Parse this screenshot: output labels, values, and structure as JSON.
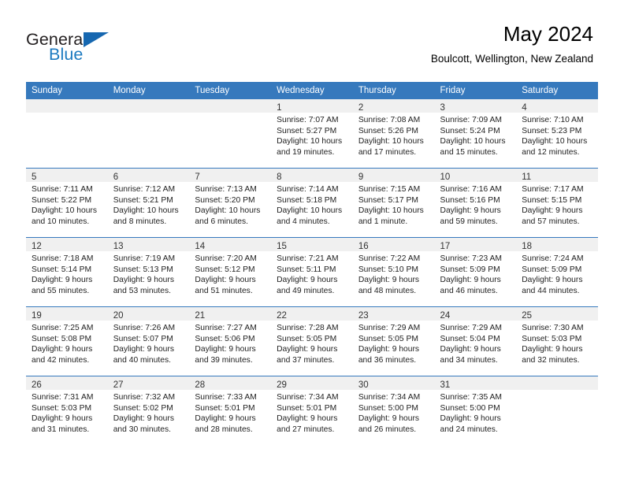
{
  "brand": {
    "name_part1": "General",
    "name_part2": "Blue",
    "triangle_icon": "triangle-icon",
    "color_dark": "#231f20",
    "color_blue": "#1c7ac0"
  },
  "header": {
    "title": "May 2024",
    "subtitle": "Boulcott, Wellington, New Zealand"
  },
  "theme": {
    "header_bg": "#3679bd",
    "daynum_bg": "#f0f0f0",
    "grid_line": "#3679bd"
  },
  "weekday_headers": [
    "Sunday",
    "Monday",
    "Tuesday",
    "Wednesday",
    "Thursday",
    "Friday",
    "Saturday"
  ],
  "weeks": [
    [
      {
        "day": "",
        "empty": true,
        "sunrise": "",
        "sunset": "",
        "daylight_1": "",
        "daylight_2": ""
      },
      {
        "day": "",
        "empty": true,
        "sunrise": "",
        "sunset": "",
        "daylight_1": "",
        "daylight_2": ""
      },
      {
        "day": "",
        "empty": true,
        "sunrise": "",
        "sunset": "",
        "daylight_1": "",
        "daylight_2": ""
      },
      {
        "day": "1",
        "sunrise": "Sunrise: 7:07 AM",
        "sunset": "Sunset: 5:27 PM",
        "daylight_1": "Daylight: 10 hours",
        "daylight_2": "and 19 minutes."
      },
      {
        "day": "2",
        "sunrise": "Sunrise: 7:08 AM",
        "sunset": "Sunset: 5:26 PM",
        "daylight_1": "Daylight: 10 hours",
        "daylight_2": "and 17 minutes."
      },
      {
        "day": "3",
        "sunrise": "Sunrise: 7:09 AM",
        "sunset": "Sunset: 5:24 PM",
        "daylight_1": "Daylight: 10 hours",
        "daylight_2": "and 15 minutes."
      },
      {
        "day": "4",
        "sunrise": "Sunrise: 7:10 AM",
        "sunset": "Sunset: 5:23 PM",
        "daylight_1": "Daylight: 10 hours",
        "daylight_2": "and 12 minutes."
      }
    ],
    [
      {
        "day": "5",
        "sunrise": "Sunrise: 7:11 AM",
        "sunset": "Sunset: 5:22 PM",
        "daylight_1": "Daylight: 10 hours",
        "daylight_2": "and 10 minutes."
      },
      {
        "day": "6",
        "sunrise": "Sunrise: 7:12 AM",
        "sunset": "Sunset: 5:21 PM",
        "daylight_1": "Daylight: 10 hours",
        "daylight_2": "and 8 minutes."
      },
      {
        "day": "7",
        "sunrise": "Sunrise: 7:13 AM",
        "sunset": "Sunset: 5:20 PM",
        "daylight_1": "Daylight: 10 hours",
        "daylight_2": "and 6 minutes."
      },
      {
        "day": "8",
        "sunrise": "Sunrise: 7:14 AM",
        "sunset": "Sunset: 5:18 PM",
        "daylight_1": "Daylight: 10 hours",
        "daylight_2": "and 4 minutes."
      },
      {
        "day": "9",
        "sunrise": "Sunrise: 7:15 AM",
        "sunset": "Sunset: 5:17 PM",
        "daylight_1": "Daylight: 10 hours",
        "daylight_2": "and 1 minute."
      },
      {
        "day": "10",
        "sunrise": "Sunrise: 7:16 AM",
        "sunset": "Sunset: 5:16 PM",
        "daylight_1": "Daylight: 9 hours",
        "daylight_2": "and 59 minutes."
      },
      {
        "day": "11",
        "sunrise": "Sunrise: 7:17 AM",
        "sunset": "Sunset: 5:15 PM",
        "daylight_1": "Daylight: 9 hours",
        "daylight_2": "and 57 minutes."
      }
    ],
    [
      {
        "day": "12",
        "sunrise": "Sunrise: 7:18 AM",
        "sunset": "Sunset: 5:14 PM",
        "daylight_1": "Daylight: 9 hours",
        "daylight_2": "and 55 minutes."
      },
      {
        "day": "13",
        "sunrise": "Sunrise: 7:19 AM",
        "sunset": "Sunset: 5:13 PM",
        "daylight_1": "Daylight: 9 hours",
        "daylight_2": "and 53 minutes."
      },
      {
        "day": "14",
        "sunrise": "Sunrise: 7:20 AM",
        "sunset": "Sunset: 5:12 PM",
        "daylight_1": "Daylight: 9 hours",
        "daylight_2": "and 51 minutes."
      },
      {
        "day": "15",
        "sunrise": "Sunrise: 7:21 AM",
        "sunset": "Sunset: 5:11 PM",
        "daylight_1": "Daylight: 9 hours",
        "daylight_2": "and 49 minutes."
      },
      {
        "day": "16",
        "sunrise": "Sunrise: 7:22 AM",
        "sunset": "Sunset: 5:10 PM",
        "daylight_1": "Daylight: 9 hours",
        "daylight_2": "and 48 minutes."
      },
      {
        "day": "17",
        "sunrise": "Sunrise: 7:23 AM",
        "sunset": "Sunset: 5:09 PM",
        "daylight_1": "Daylight: 9 hours",
        "daylight_2": "and 46 minutes."
      },
      {
        "day": "18",
        "sunrise": "Sunrise: 7:24 AM",
        "sunset": "Sunset: 5:09 PM",
        "daylight_1": "Daylight: 9 hours",
        "daylight_2": "and 44 minutes."
      }
    ],
    [
      {
        "day": "19",
        "sunrise": "Sunrise: 7:25 AM",
        "sunset": "Sunset: 5:08 PM",
        "daylight_1": "Daylight: 9 hours",
        "daylight_2": "and 42 minutes."
      },
      {
        "day": "20",
        "sunrise": "Sunrise: 7:26 AM",
        "sunset": "Sunset: 5:07 PM",
        "daylight_1": "Daylight: 9 hours",
        "daylight_2": "and 40 minutes."
      },
      {
        "day": "21",
        "sunrise": "Sunrise: 7:27 AM",
        "sunset": "Sunset: 5:06 PM",
        "daylight_1": "Daylight: 9 hours",
        "daylight_2": "and 39 minutes."
      },
      {
        "day": "22",
        "sunrise": "Sunrise: 7:28 AM",
        "sunset": "Sunset: 5:05 PM",
        "daylight_1": "Daylight: 9 hours",
        "daylight_2": "and 37 minutes."
      },
      {
        "day": "23",
        "sunrise": "Sunrise: 7:29 AM",
        "sunset": "Sunset: 5:05 PM",
        "daylight_1": "Daylight: 9 hours",
        "daylight_2": "and 36 minutes."
      },
      {
        "day": "24",
        "sunrise": "Sunrise: 7:29 AM",
        "sunset": "Sunset: 5:04 PM",
        "daylight_1": "Daylight: 9 hours",
        "daylight_2": "and 34 minutes."
      },
      {
        "day": "25",
        "sunrise": "Sunrise: 7:30 AM",
        "sunset": "Sunset: 5:03 PM",
        "daylight_1": "Daylight: 9 hours",
        "daylight_2": "and 32 minutes."
      }
    ],
    [
      {
        "day": "26",
        "sunrise": "Sunrise: 7:31 AM",
        "sunset": "Sunset: 5:03 PM",
        "daylight_1": "Daylight: 9 hours",
        "daylight_2": "and 31 minutes."
      },
      {
        "day": "27",
        "sunrise": "Sunrise: 7:32 AM",
        "sunset": "Sunset: 5:02 PM",
        "daylight_1": "Daylight: 9 hours",
        "daylight_2": "and 30 minutes."
      },
      {
        "day": "28",
        "sunrise": "Sunrise: 7:33 AM",
        "sunset": "Sunset: 5:01 PM",
        "daylight_1": "Daylight: 9 hours",
        "daylight_2": "and 28 minutes."
      },
      {
        "day": "29",
        "sunrise": "Sunrise: 7:34 AM",
        "sunset": "Sunset: 5:01 PM",
        "daylight_1": "Daylight: 9 hours",
        "daylight_2": "and 27 minutes."
      },
      {
        "day": "30",
        "sunrise": "Sunrise: 7:34 AM",
        "sunset": "Sunset: 5:00 PM",
        "daylight_1": "Daylight: 9 hours",
        "daylight_2": "and 26 minutes."
      },
      {
        "day": "31",
        "sunrise": "Sunrise: 7:35 AM",
        "sunset": "Sunset: 5:00 PM",
        "daylight_1": "Daylight: 9 hours",
        "daylight_2": "and 24 minutes."
      },
      {
        "day": "",
        "empty": true,
        "sunrise": "",
        "sunset": "",
        "daylight_1": "",
        "daylight_2": ""
      }
    ]
  ]
}
